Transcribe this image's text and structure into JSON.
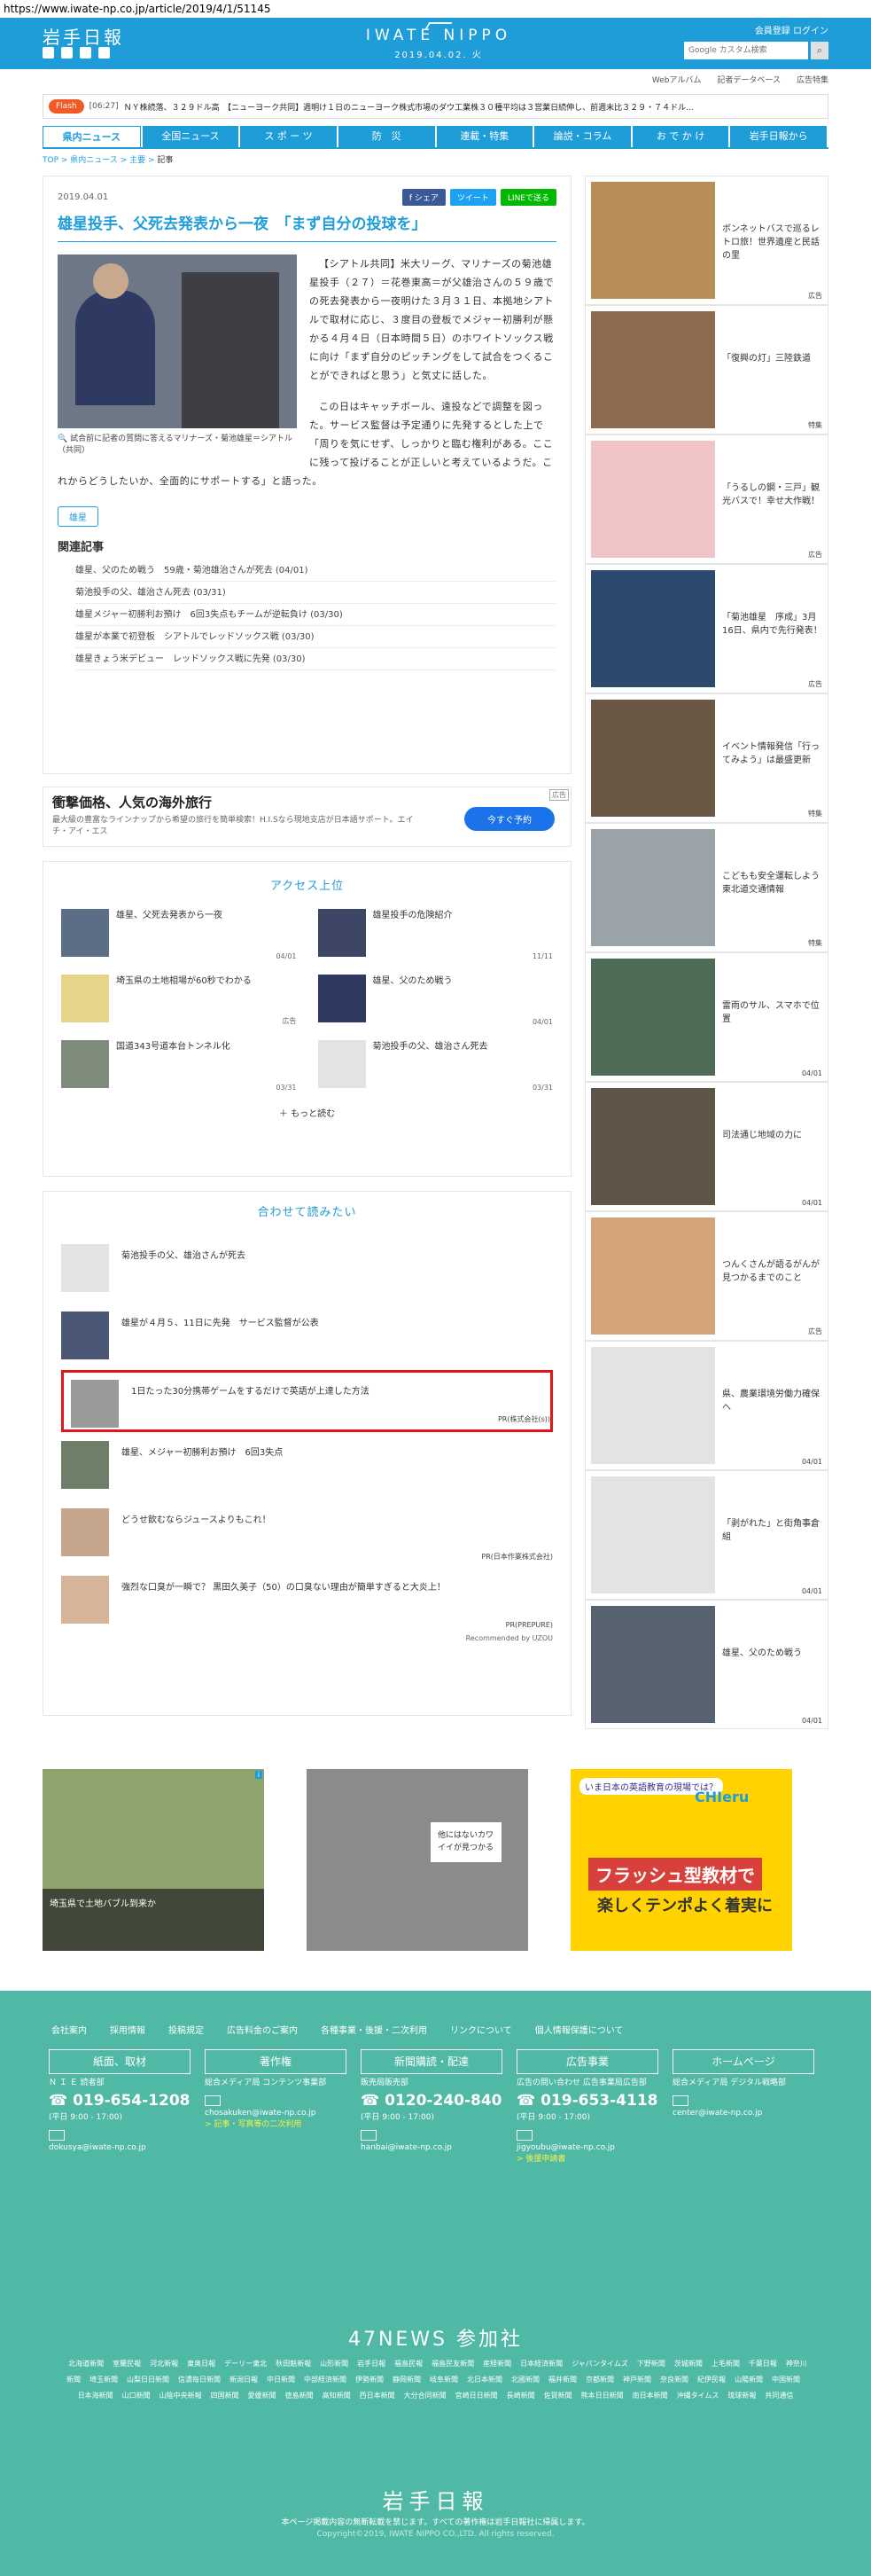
{
  "url": "https://www.iwate-np.co.jp/article/2019/4/1/51145",
  "header": {
    "logo": "岩手日報",
    "brand": "IWATE NIPPO",
    "date": "2019.04.02. 火",
    "links": "会員登録 ログイン",
    "search_placeholder": "Google カスタム検索",
    "sublinks": [
      "Webアルバム",
      "記者データベース",
      "広告特集"
    ]
  },
  "flash": {
    "tag": "Flash",
    "time": "[06:27]",
    "text": "ＮＹ株続落、３２９ドル高　【ニューヨーク共同】週明け１日のニューヨーク株式市場のダウ工業株３０種平均は３営業日続伸し、前週末比３２９・７４ドル..."
  },
  "nav": [
    "県内ニュース",
    "全国ニュース",
    "ス ポ ー ツ",
    "防　災",
    "連載・特集",
    "論説・コラム",
    "お で か け",
    "岩手日報から"
  ],
  "breadcrumb": {
    "top": "TOP",
    "cat": "県内ニュース",
    "sub": "主要",
    "cur": "記事"
  },
  "article": {
    "date": "2019.04.01",
    "share_fb": "f シェア",
    "share_tw": "ツイート",
    "share_line": "LINEで送る",
    "title": "雄星投手、父死去発表から一夜　「まず自分の投球を」",
    "caption": "試合前に記者の質問に答えるマリナーズ・菊池雄星＝シアトル（共同）",
    "p1": "【シアトル共同】米大リーグ、マリナーズの菊池雄星投手（２７）＝花巻東高＝が父雄治さんの５９歳での死去発表から一夜明けた３月３１日、本拠地シアトルで取材に応じ、３度目の登板でメジャー初勝利が懸かる４月４日（日本時間５日）のホワイトソックス戦に向け「まず自分のピッチングをして試合をつくることができればと思う」と気丈に話した。",
    "p2": "この日はキャッチボール、遠投などで調整を図った。サービス監督は予定通りに先発するとした上で「周りを気にせず、しっかりと臨む権利がある。ここに残って投げることが正しいと考えているようだ。これからどうしたいか、全面的にサポートする」と語った。",
    "tag": "雄星",
    "related_title": "関連記事",
    "related": [
      "雄星、父のため戦う　59歳・菊池雄治さんが死去 (04/01)",
      "菊池投手の父、雄治さん死去 (03/31)",
      "雄星メジャー初勝利お預け　6回3失点もチームが逆転負け (03/30)",
      "雄星が本業で初登板　シアトルでレッドソックス戦 (03/30)",
      "雄星きょう米デビュー　レッドソックス戦に先発 (03/30)"
    ]
  },
  "ad_strip": {
    "title": "衝撃価格、人気の海外旅行",
    "sub": "最大級の豊富なラインナップから希望の旅行を簡単検索！H.I.Sなら現地支店が日本語サポート。エイチ・アイ・エス",
    "button": "今すぐ予約",
    "mark": "広告"
  },
  "access": {
    "title": "アクセス上位",
    "items": [
      {
        "text": "雄星、父死去発表から一夜",
        "date": "04/01"
      },
      {
        "text": "雄星投手の危険紹介",
        "date": "11/11"
      },
      {
        "text": "埼玉県の土地相場が60秒でわかる",
        "date": "広告"
      },
      {
        "text": "雄星、父のため戦う",
        "date": "04/01"
      },
      {
        "text": "国道343号道本台トンネル化",
        "date": "03/31"
      },
      {
        "text": "菊池投手の父、雄治さん死去",
        "date": "03/31"
      }
    ],
    "more": "もっと読む"
  },
  "read": {
    "title": "合わせて読みたい",
    "items": [
      {
        "text": "菊池投手の父、雄治さんが死去",
        "pr": ""
      },
      {
        "text": "雄星が４月５、11日に先発　サービス監督が公表",
        "pr": ""
      },
      {
        "text": "1日たった30分携帯ゲームをするだけで英語が上達した方法",
        "pr": "PR(株式会社(s))"
      },
      {
        "text": "雄星、メジャー初勝利お預け　6回3失点",
        "pr": ""
      },
      {
        "text": "どうせ飲むならジュースよりもこれ！",
        "pr": "PR(日本作業株式会社)"
      },
      {
        "text": "強烈な口臭が一瞬で？ 黒田久美子（50）の口臭ない理由が簡単すぎると大炎上！",
        "pr": "PR(PREPURE)"
      }
    ],
    "recommended": "Recommended by UZOU"
  },
  "side": [
    {
      "text": "ボンネットバスで巡るレトロ旅！世界遺産と民話の里",
      "label": "広告",
      "color": "#b88d56"
    },
    {
      "text": "「復興の灯」三陸鉄道",
      "label": "特集",
      "color": "#8c6b4f"
    },
    {
      "text": "「うるしの鋼・三戸」観光バスで！幸せ大作戦！",
      "label": "広告",
      "color": "#f1c5c8"
    },
    {
      "text": "「菊池雄星　序成」3月16日、県内で先行発表！",
      "label": "広告",
      "color": "#2c4a6e"
    },
    {
      "text": "イベント情報発信「行ってみよう」は最盛更新",
      "label": "特集",
      "color": "#6b5844"
    },
    {
      "text": "こどもも安全運転しよう　東北道交通情報",
      "label": "特集",
      "color": "#9aa3a8"
    },
    {
      "text": "雷雨のサル、スマホで位置",
      "label": "04/01",
      "color": "#4f6d56"
    },
    {
      "text": "司法通じ地域の力に",
      "label": "04/01",
      "color": "#5e5547"
    },
    {
      "text": "つんくさんが語るがんが見つかるまでのこと",
      "label": "広告",
      "color": "#d5a37a"
    },
    {
      "text": "県、農業環境労働力確保へ",
      "label": "04/01",
      "color": "#e3e3e3"
    },
    {
      "text": "「剥がれた」と街角事倉組",
      "label": "04/01",
      "color": "#e3e3e3"
    },
    {
      "text": "雄星、父のため戦う",
      "label": "04/01",
      "color": "#566270"
    }
  ],
  "bottom_ads": {
    "map_caption": "埼玉県で土地バブル到来か",
    "knit_caption": "他にはないカワイイが見つかる",
    "kids_t1": "いま日本の英語教育の現場では？",
    "kids_t2": "フラッシュ型教材で",
    "kids_t3": "楽しくテンポよく着実に",
    "kids_brand": "CHIeru"
  },
  "footer": {
    "links": [
      "会社案内",
      "採用情報",
      "投稿規定",
      "広告料金のご案内",
      "各種事業・後援・二次利用",
      "リンクについて",
      "個人情報保護について"
    ],
    "cols": [
      {
        "head": "紙面、取材",
        "l1": "Ｎ Ｉ Ｅ 読者部",
        "tel": "019-654-1208",
        "hours": "(平日 9:00 - 17:00)",
        "mail": "dokusya@iwate-np.co.jp",
        "extra": ""
      },
      {
        "head": "著作権",
        "l1": "総合メディア局 コンテンツ事業部",
        "tel": "",
        "hours": "",
        "mail": "chosakuken@iwate-np.co.jp",
        "extra": "> 記事・写真等の二次利用"
      },
      {
        "head": "新聞購読・配達",
        "l1": "販売局販売部",
        "tel": "0120-240-840",
        "hours": "(平日 9:00 - 17:00)",
        "mail": "hanbai@iwate-np.co.jp",
        "extra": ""
      },
      {
        "head": "広告事業",
        "l1": "広告の問い合わせ 広告事業局広告部",
        "tel": "019-653-4118",
        "hours": "(平日 9:00 - 17:00)",
        "mail": "jigyoubu@iwate-np.co.jp",
        "extra": "> 後援申請書"
      },
      {
        "head": "ホームページ",
        "l1": "総合メディア局 デジタル戦略部",
        "tel": "",
        "hours": "",
        "mail": "center@iwate-np.co.jp",
        "extra": ""
      }
    ],
    "news_title": "47NEWS 参加社",
    "news": [
      "北海道新聞",
      "室蘭民報",
      "河北新報",
      "東奥日報",
      "デーリー東北",
      "秋田魁新報",
      "山形新聞",
      "岩手日報",
      "福島民報",
      "福島民友新聞",
      "産経新聞",
      "日本経済新聞",
      "ジャパンタイムズ",
      "下野新聞",
      "茨城新聞",
      "上毛新聞",
      "千葉日報",
      "神奈川新聞",
      "埼玉新聞",
      "山梨日日新聞",
      "信濃毎日新聞",
      "新潟日報",
      "中日新聞",
      "中部経済新聞",
      "伊勢新聞",
      "静岡新聞",
      "岐阜新聞",
      "北日本新聞",
      "北國新聞",
      "福井新聞",
      "京都新聞",
      "神戸新聞",
      "奈良新聞",
      "紀伊民報",
      "山陽新聞",
      "中国新聞",
      "日本海新聞",
      "山口新聞",
      "山陰中央新報",
      "四国新聞",
      "愛媛新聞",
      "徳島新聞",
      "高知新聞",
      "西日本新聞",
      "大分合同新聞",
      "宮崎日日新聞",
      "長崎新聞",
      "佐賀新聞",
      "熊本日日新聞",
      "南日本新聞",
      "沖縄タイムス",
      "琉球新報",
      "共同通信"
    ],
    "logo": "岩手日報",
    "note": "本ページ掲載内容の無断転載を禁じます。すべての著作権は岩手日報社に帰属します。",
    "copy": "Copyright©2019, IWATE NIPPO CO.,LTD. All rights reserved."
  }
}
